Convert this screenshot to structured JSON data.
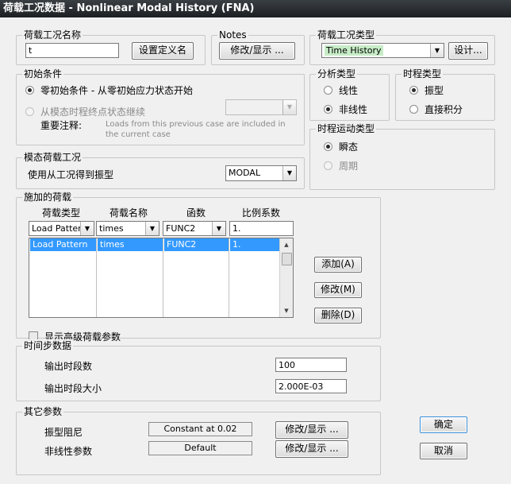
{
  "window": {
    "title": "荷载工况数据 - Nonlinear Modal History (FNA)"
  },
  "case_name": {
    "legend": "荷载工况名称",
    "value": "t",
    "define_button": "设置定义名"
  },
  "notes": {
    "legend": "Notes",
    "button": "修改/显示 ..."
  },
  "case_type": {
    "legend": "荷载工况类型",
    "selected": "Time History",
    "design_button": "设计..."
  },
  "initial_conditions": {
    "legend": "初始条件",
    "opt_zero": "零初始条件 - 从零初始应力状态开始",
    "opt_continue": "从模态时程终点状态继续",
    "note_label": "重要注释:",
    "note_text": "Loads from this previous case are included in the current case"
  },
  "analysis_type": {
    "legend": "分析类型",
    "linear": "线性",
    "nonlinear": "非线性"
  },
  "history_type": {
    "legend": "时程类型",
    "modal": "振型",
    "direct": "直接积分"
  },
  "motion_type": {
    "legend": "时程运动类型",
    "transient": "瞬态",
    "periodic": "周期"
  },
  "modal_case": {
    "legend": "模态荷载工况",
    "label": "使用从工况得到振型",
    "selected": "MODAL"
  },
  "loads": {
    "legend": "施加的荷载",
    "headers": [
      "荷载类型",
      "荷载名称",
      "函数",
      "比例系数"
    ],
    "edit_row": [
      "Load Pattern",
      "times",
      "FUNC2",
      "1."
    ],
    "rows": [
      [
        "Load Pattern",
        "times",
        "FUNC2",
        "1."
      ]
    ],
    "add_button": "添加(A)",
    "modify_button": "修改(M)",
    "delete_button": "删除(D)",
    "advanced_label": "显示高级荷载参数"
  },
  "time_step": {
    "legend": "时间步数据",
    "steps_label": "输出时段数",
    "steps_value": "100",
    "size_label": "输出时段大小",
    "size_value": "2.000E-03"
  },
  "other": {
    "legend": "其它参数",
    "damping_label": "振型阻尼",
    "damping_value": "Constant at 0.02",
    "damping_button": "修改/显示 ...",
    "nonlinear_label": "非线性参数",
    "nonlinear_value": "Default",
    "nonlinear_button": "修改/显示 ..."
  },
  "ok_button": "确定",
  "cancel_button": "取消"
}
